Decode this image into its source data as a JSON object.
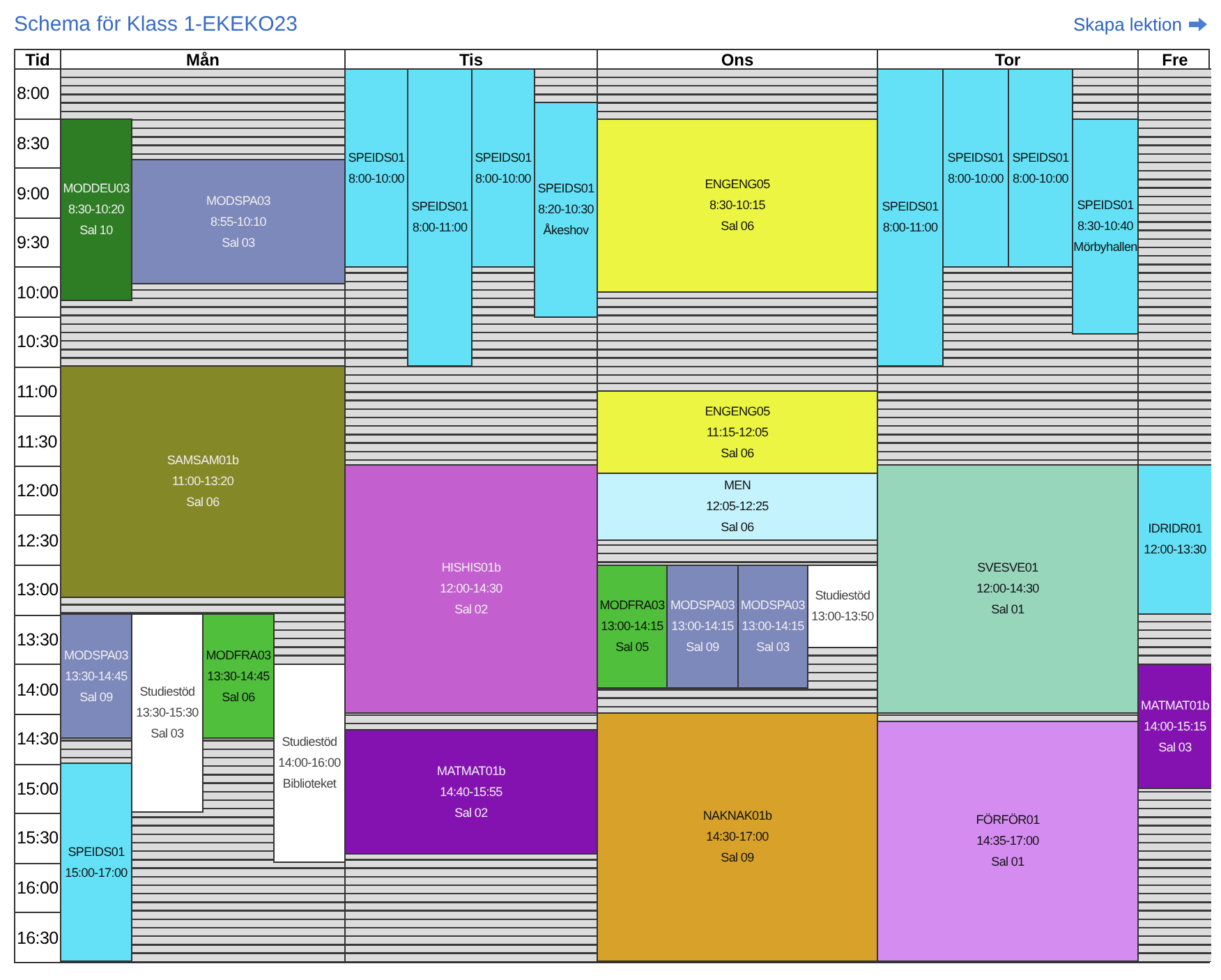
{
  "title": "Schema för Klass 1-EKEKO23",
  "create_link": "Skapa lektion",
  "time_header": "Tid",
  "times": [
    "8:00",
    "8:30",
    "9:00",
    "9:30",
    "10:00",
    "10:30",
    "11:00",
    "11:30",
    "12:00",
    "12:30",
    "13:00",
    "13:30",
    "14:00",
    "14:30",
    "15:00",
    "15:30",
    "16:00",
    "16:30"
  ],
  "days": [
    {
      "name": "Mån",
      "events": [
        {
          "course": "MODDEU03",
          "time": "8:30-10:20",
          "room": "Sal 10",
          "color": "#2e7d24"
        },
        {
          "course": "MODSPA03",
          "time": "8:55-10:10",
          "room": "Sal 03",
          "color": "#7d88bb"
        },
        {
          "course": "SAMSAM01b",
          "time": "11:00-13:20",
          "room": "Sal 06",
          "color": "#858826"
        },
        {
          "course": "MODSPA03",
          "time": "13:30-14:45",
          "room": "Sal 09",
          "color": "#7d88bb"
        },
        {
          "course": "Studiestöd",
          "time": "13:30-15:30",
          "room": "Sal 03",
          "color": "#ffffff"
        },
        {
          "course": "MODFRA03",
          "time": "13:30-14:45",
          "room": "Sal 06",
          "color": "#4fbf3c"
        },
        {
          "course": "Studiestöd",
          "time": "14:00-16:00",
          "room": "Biblioteket",
          "color": "#ffffff"
        },
        {
          "course": "SPEIDS01",
          "time": "15:00-17:00",
          "color": "#64e1f7"
        }
      ]
    },
    {
      "name": "Tis",
      "events": [
        {
          "course": "SPEIDS01",
          "time": "8:00-10:00",
          "color": "#64e1f7"
        },
        {
          "course": "SPEIDS01",
          "time": "8:00-11:00",
          "color": "#64e1f7"
        },
        {
          "course": "SPEIDS01",
          "time": "8:00-10:00",
          "color": "#64e1f7"
        },
        {
          "course": "SPEIDS01",
          "time": "8:20-10:30",
          "room": "Åkeshov",
          "color": "#64e1f7"
        },
        {
          "course": "HISHIS01b",
          "time": "12:00-14:30",
          "room": "Sal 02",
          "color": "#c35fce"
        },
        {
          "course": "MATMAT01b",
          "time": "14:40-15:55",
          "room": "Sal 02",
          "color": "#8412b0"
        }
      ]
    },
    {
      "name": "Ons",
      "events": [
        {
          "course": "ENGENG05",
          "time": "8:30-10:15",
          "room": "Sal 06",
          "color": "#ebf542"
        },
        {
          "course": "ENGENG05",
          "time": "11:15-12:05",
          "room": "Sal 06",
          "color": "#ebf542"
        },
        {
          "course": "MEN",
          "time": "12:05-12:25",
          "room": "Sal 06",
          "color": "#c4f3fd"
        },
        {
          "course": "MODFRA03",
          "time": "13:00-14:15",
          "room": "Sal 05",
          "color": "#4fbf3c"
        },
        {
          "course": "MODSPA03",
          "time": "13:00-14:15",
          "room": "Sal 09",
          "color": "#7d88bb"
        },
        {
          "course": "MODSPA03",
          "time": "13:00-14:15",
          "room": "Sal 03",
          "color": "#7d88bb"
        },
        {
          "course": "Studiestöd",
          "time": "13:00-13:50",
          "color": "#ffffff"
        },
        {
          "course": "NAKNAK01b",
          "time": "14:30-17:00",
          "room": "Sal 09",
          "color": "#d8a22a"
        }
      ]
    },
    {
      "name": "Tor",
      "events": [
        {
          "course": "SPEIDS01",
          "time": "8:00-11:00",
          "color": "#64e1f7"
        },
        {
          "course": "SPEIDS01",
          "time": "8:00-10:00",
          "color": "#64e1f7"
        },
        {
          "course": "SPEIDS01",
          "time": "8:00-10:00",
          "color": "#64e1f7"
        },
        {
          "course": "SPEIDS01",
          "time": "8:30-10:40",
          "room": "Mörbyhallen",
          "color": "#64e1f7"
        },
        {
          "course": "SVESVE01",
          "time": "12:00-14:30",
          "room": "Sal 01",
          "color": "#98d6bc"
        },
        {
          "course": "FÖRFÖR01",
          "time": "14:35-17:00",
          "room": "Sal 01",
          "color": "#d48cf0"
        }
      ]
    },
    {
      "name": "Fre",
      "events": [
        {
          "course": "IDRIDR01",
          "time": "12:00-13:30",
          "color": "#64e1f7"
        },
        {
          "course": "MATMAT01b",
          "time": "14:00-15:15",
          "room": "Sal 03",
          "color": "#8412b0"
        }
      ]
    }
  ]
}
